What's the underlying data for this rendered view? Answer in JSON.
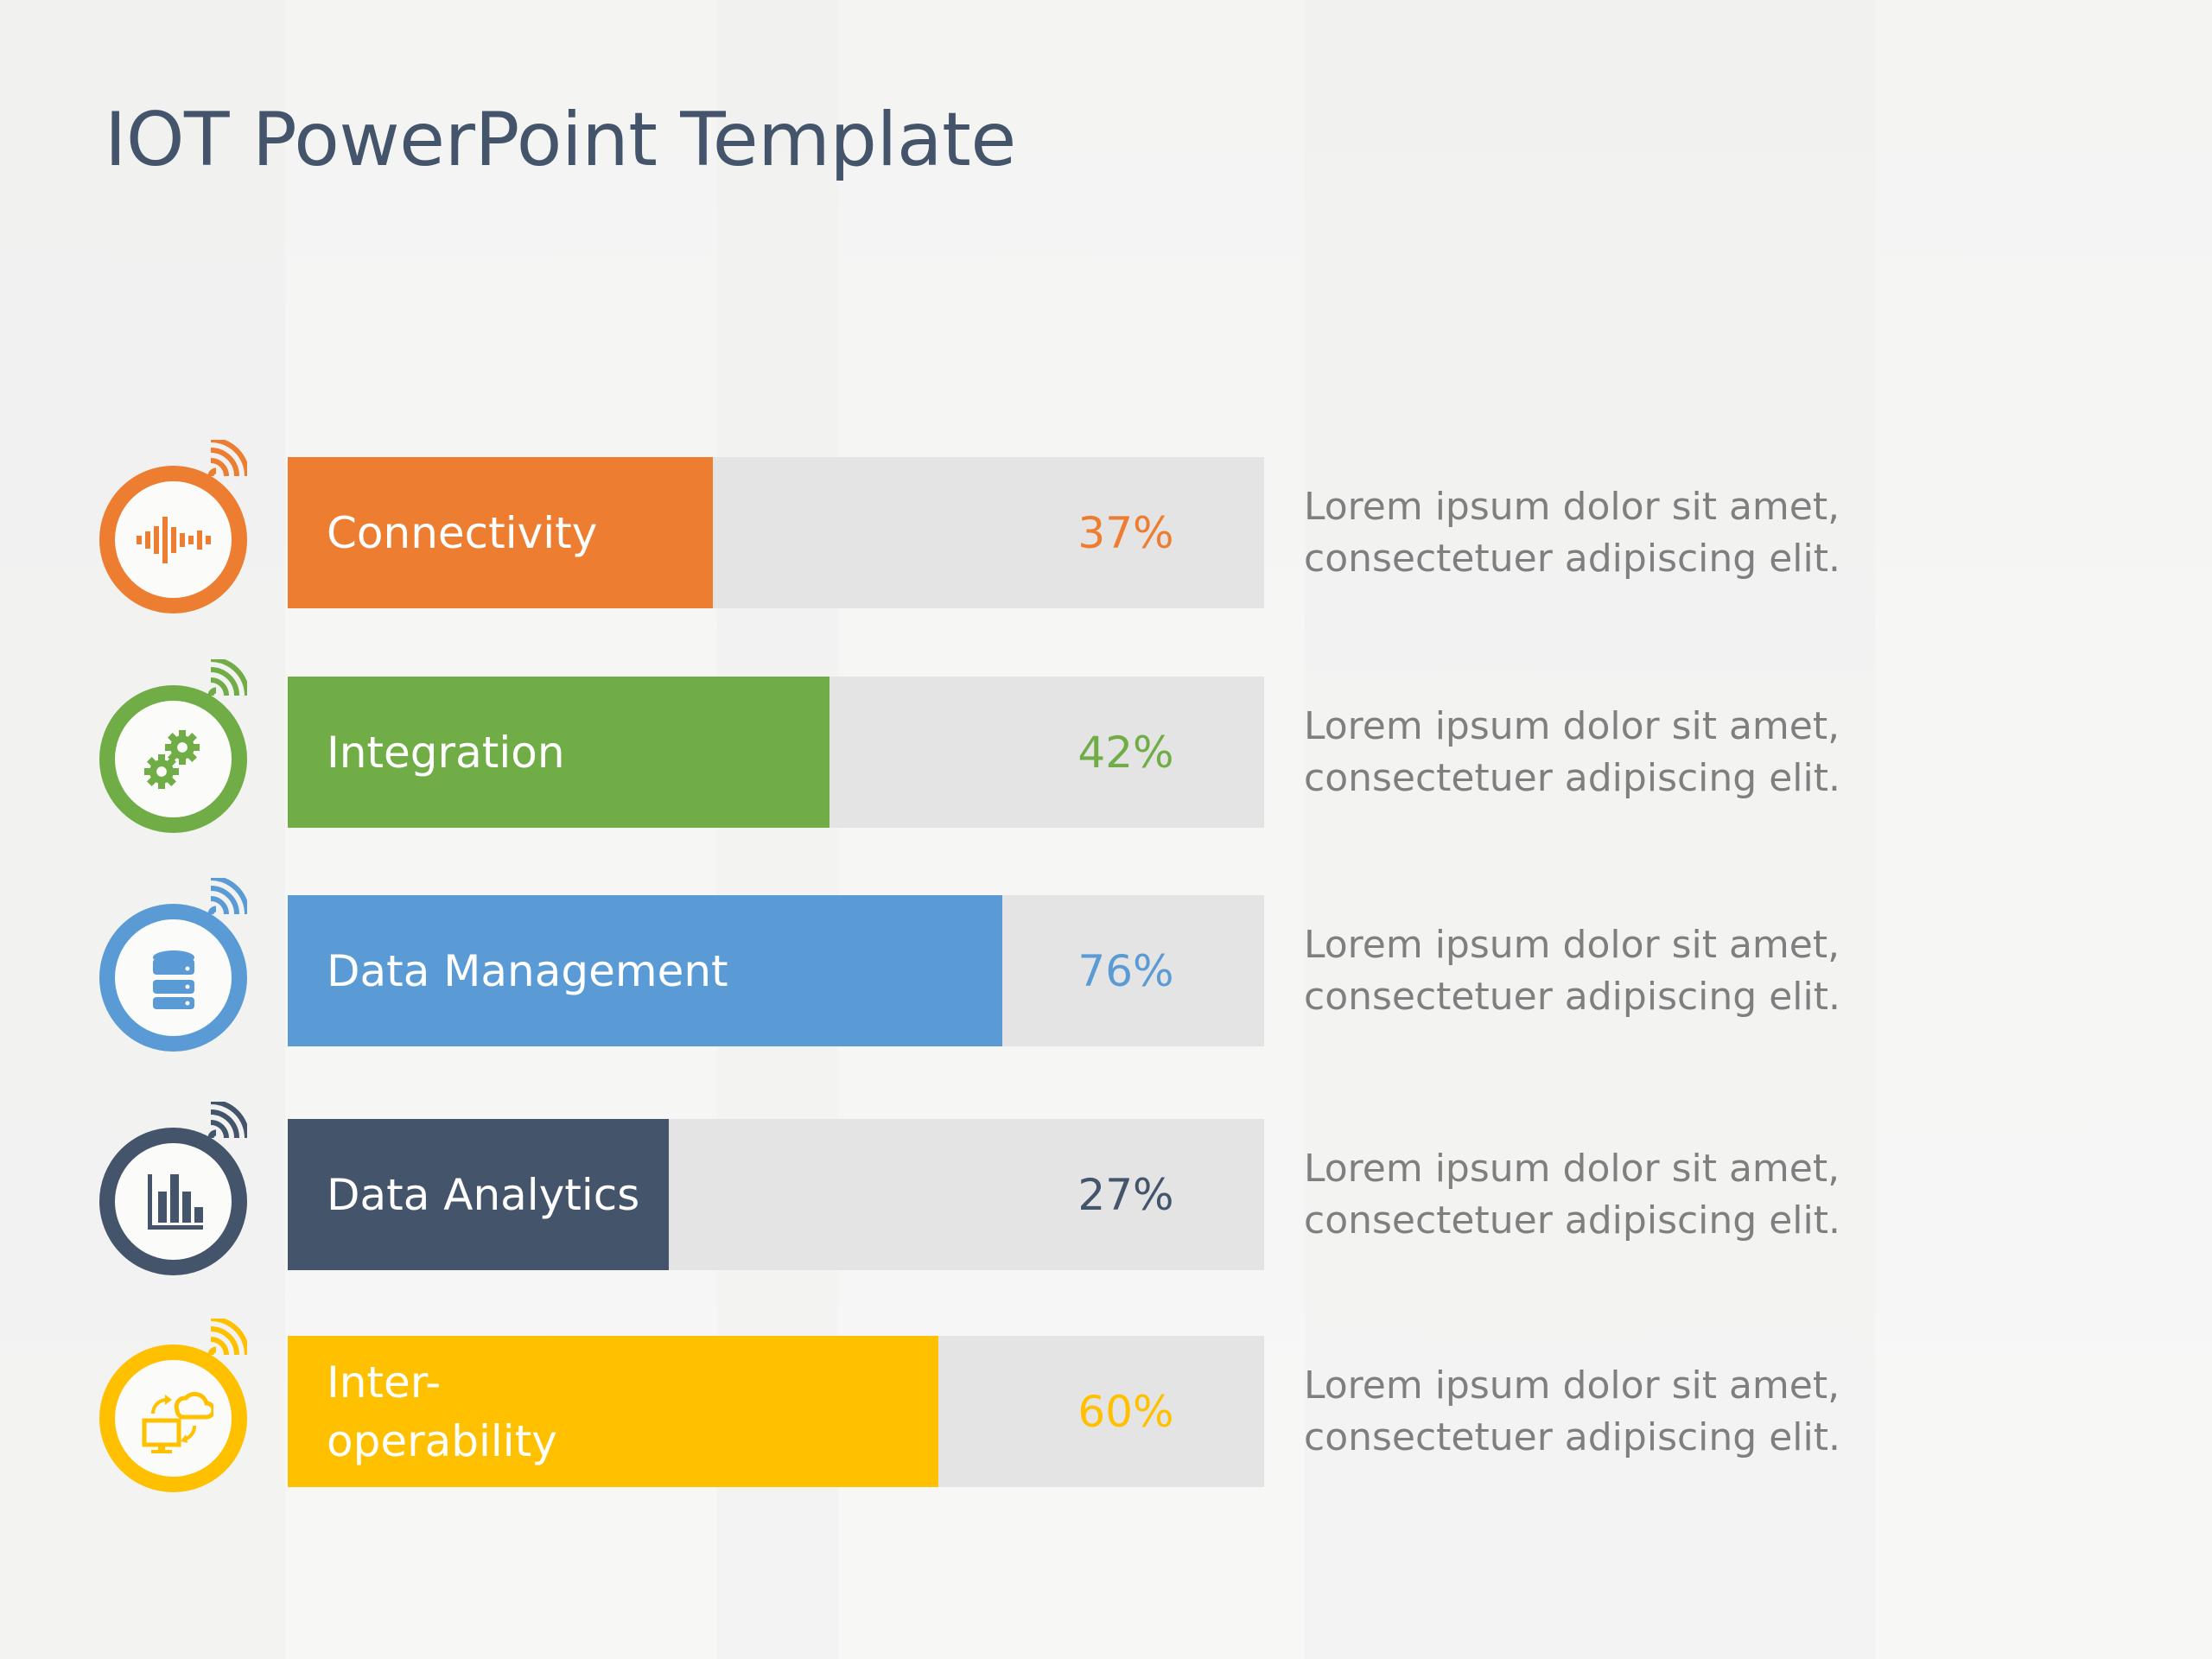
{
  "slide": {
    "title": "IOT PowerPoint Template"
  },
  "colors": {
    "track": "#E4E4E4",
    "title": "#44546A",
    "body_text": "#7F7F7F"
  },
  "rows": [
    {
      "label": "Connectivity",
      "percent_label": "37%",
      "percent": 37,
      "fill_fraction": 0.435,
      "color": "#ED7D31",
      "icon": "sound-wave-icon",
      "description": "Lorem ipsum dolor sit amet, consectetuer adipiscing elit."
    },
    {
      "label": "Integration",
      "percent_label": "42%",
      "percent": 42,
      "fill_fraction": 0.555,
      "color": "#70AD47",
      "icon": "gears-icon",
      "description": "Lorem ipsum dolor sit amet, consectetuer adipiscing elit."
    },
    {
      "label": "Data Management",
      "percent_label": "76%",
      "percent": 76,
      "fill_fraction": 0.732,
      "color": "#5B9BD5",
      "icon": "database-icon",
      "description": "Lorem ipsum dolor sit amet, consectetuer adipiscing elit."
    },
    {
      "label": "Data Analytics",
      "percent_label": "27%",
      "percent": 27,
      "fill_fraction": 0.39,
      "color": "#44546A",
      "icon": "bar-chart-icon",
      "description": "Lorem ipsum dolor sit amet, consectetuer adipiscing elit."
    },
    {
      "label": "Inter-\noperability",
      "percent_label": "60%",
      "percent": 60,
      "fill_fraction": 0.666,
      "color": "#FFC000",
      "icon": "cloud-sync-icon",
      "description": "Lorem ipsum dolor sit amet, consectetuer adipiscing elit."
    }
  ]
}
